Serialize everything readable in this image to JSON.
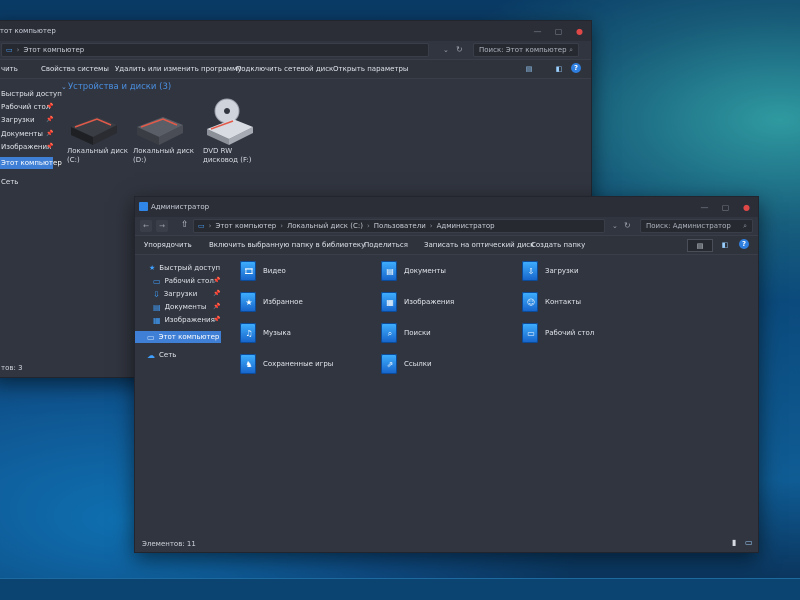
{
  "back_window": {
    "title": "Этот компьютер",
    "address": "Этот компьютер",
    "search_placeholder": "Поиск: Этот компьютер",
    "toolbar": [
      "Свойства системы",
      "Удалить или изменить программу",
      "Подключить сетевой диск",
      "Открыть параметры"
    ],
    "toolbar_first_partial": "чить",
    "section_title": "Устройства и диски (3)",
    "nav_items": [
      {
        "label": "Быстрый доступ",
        "pinned": false
      },
      {
        "label": "Рабочий стол",
        "pinned": true
      },
      {
        "label": "Загрузки",
        "pinned": true
      },
      {
        "label": "Документы",
        "pinned": true
      },
      {
        "label": "Изображения",
        "pinned": true
      },
      {
        "label": "Этот компьютер",
        "pinned": false,
        "selected": true
      },
      {
        "label": "Сеть",
        "pinned": false
      }
    ],
    "drives": [
      {
        "line1": "Локальный диск",
        "line2": "(C:)",
        "icon": "hard-drive-icon"
      },
      {
        "line1": "Локальный диск",
        "line2": "(D:)",
        "icon": "hard-drive-icon"
      },
      {
        "line1": "DVD RW",
        "line2": "дисковод (F:)",
        "icon": "dvd-drive-icon"
      }
    ],
    "status": "тов: 3"
  },
  "front_window": {
    "title": "Администратор",
    "breadcrumb": [
      "Этот компьютер",
      "Локальный диск (C:)",
      "Пользователи",
      "Администратор"
    ],
    "search_placeholder": "Поиск: Администратор",
    "toolbar": [
      "Упорядочить",
      "Включить выбранную папку в библиотеку",
      "Поделиться",
      "Записать на оптический диск",
      "Создать папку"
    ],
    "nav_items": [
      {
        "label": "Быстрый доступ",
        "icon": "star-icon",
        "pinned": false
      },
      {
        "label": "Рабочий стол",
        "icon": "desktop-icon",
        "pinned": true
      },
      {
        "label": "Загрузки",
        "icon": "download-icon",
        "pinned": true
      },
      {
        "label": "Документы",
        "icon": "documents-icon",
        "pinned": true
      },
      {
        "label": "Изображения",
        "icon": "pictures-icon",
        "pinned": true
      },
      {
        "label": "Этот компьютер",
        "icon": "computer-icon",
        "pinned": false,
        "selected": true
      },
      {
        "label": "Сеть",
        "icon": "network-icon",
        "pinned": false
      }
    ],
    "folders": [
      {
        "label": "Видео",
        "icon": "video-folder-icon",
        "glyph": "🎞"
      },
      {
        "label": "Документы",
        "icon": "documents-folder-icon",
        "glyph": "▤"
      },
      {
        "label": "Загрузки",
        "icon": "downloads-folder-icon",
        "glyph": "⇩"
      },
      {
        "label": "Избранное",
        "icon": "favorites-folder-icon",
        "glyph": "★"
      },
      {
        "label": "Изображения",
        "icon": "pictures-folder-icon",
        "glyph": "▦"
      },
      {
        "label": "Контакты",
        "icon": "contacts-folder-icon",
        "glyph": "☺"
      },
      {
        "label": "Музыка",
        "icon": "music-folder-icon",
        "glyph": "♫"
      },
      {
        "label": "Поиски",
        "icon": "searches-folder-icon",
        "glyph": "⌕"
      },
      {
        "label": "Рабочий стол",
        "icon": "desktop-folder-icon",
        "glyph": "▭"
      },
      {
        "label": "Сохраненные игры",
        "icon": "saved-games-folder-icon",
        "glyph": "♞"
      },
      {
        "label": "Ссылки",
        "icon": "links-folder-icon",
        "glyph": "⇗"
      }
    ],
    "status": "Элементов: 11"
  },
  "colors": {
    "accent": "#3f7fd6",
    "window_bg": "#31353f",
    "section_title": "#4a90e2",
    "close": "#e04848"
  }
}
